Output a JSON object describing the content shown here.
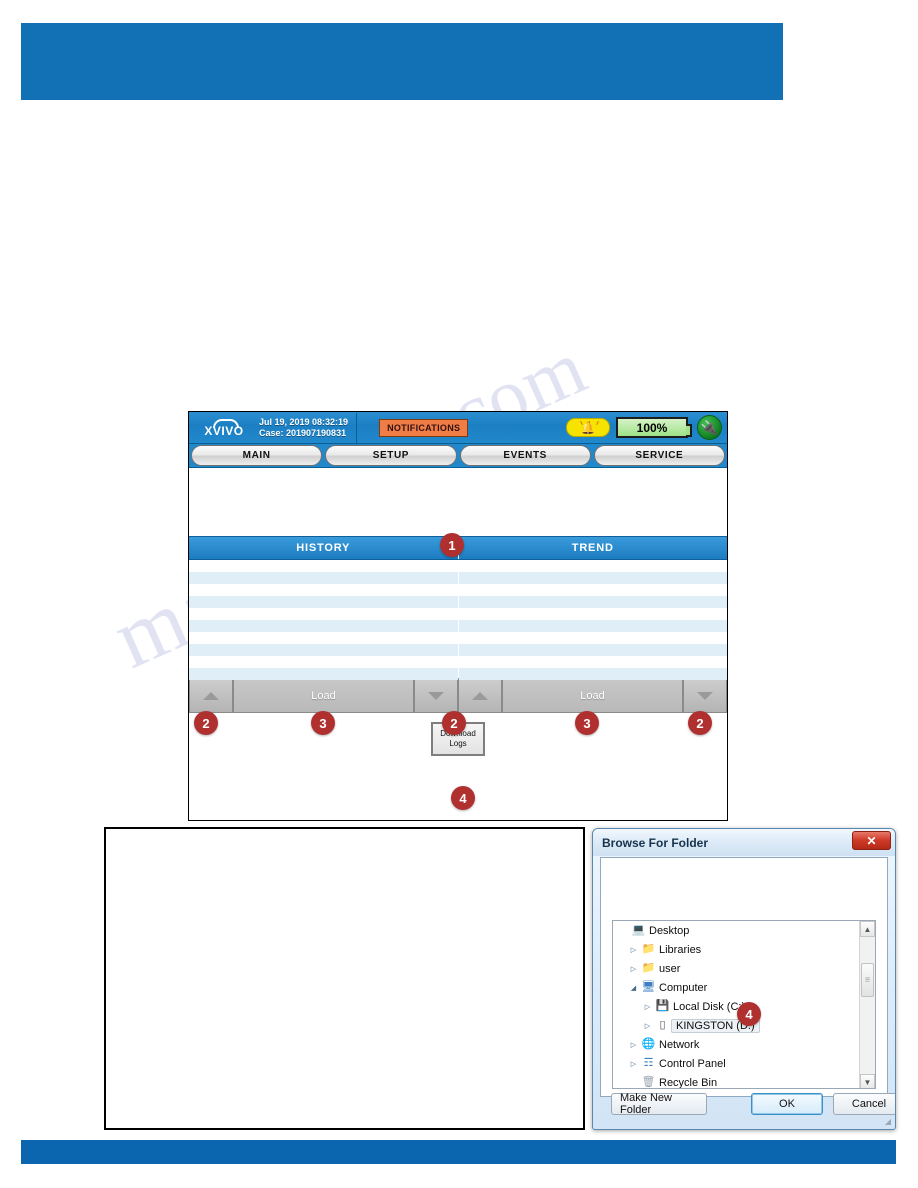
{
  "page": {
    "header_band_color": "#1271b5",
    "footer_band_color": "#0b65af",
    "watermark_text_1": "manualshive",
    "watermark_text_2": ".com"
  },
  "device": {
    "logo_text": "XVIVO",
    "datetime": "Jul 19, 2019 08:32:19",
    "case": "Case: 201907190831",
    "notifications_label": "NOTIFICATIONS",
    "battery_level": "100%",
    "alarm_icon": "bell-icon",
    "plug_icon": "power-plug-icon",
    "tabs": [
      {
        "label": "MAIN"
      },
      {
        "label": "SETUP"
      },
      {
        "label": "EVENTS"
      },
      {
        "label": "SERVICE"
      }
    ],
    "panels": [
      {
        "header": "HISTORY",
        "load_label": "Load",
        "up_icon": "triangle-up-icon",
        "down_icon": "triangle-down-icon"
      },
      {
        "header": "TREND",
        "load_label": "Load",
        "up_icon": "triangle-up-icon",
        "down_icon": "triangle-down-icon"
      }
    ],
    "download_logs": {
      "line1": "Download",
      "line2": "Logs"
    }
  },
  "callouts": {
    "c1": "1",
    "c2a": "2",
    "c2b": "2",
    "c2c": "2",
    "c3a": "3",
    "c3b": "3",
    "c4_device": "4",
    "c4_dialog": "4"
  },
  "dialog": {
    "title": "Browse For Folder",
    "close_label": "✕",
    "tree": [
      {
        "label": "Desktop",
        "indent": 0,
        "expander": "",
        "icon": "monitor-icon",
        "selected": false
      },
      {
        "label": "Libraries",
        "indent": 1,
        "expander": "▷",
        "icon": "folder-icon",
        "selected": false
      },
      {
        "label": "user",
        "indent": 1,
        "expander": "▷",
        "icon": "user-folder-icon",
        "selected": false
      },
      {
        "label": "Computer",
        "indent": 1,
        "expander": "◢",
        "icon": "computer-icon",
        "selected": false
      },
      {
        "label": "Local Disk (C:)",
        "indent": 2,
        "expander": "▷",
        "icon": "hard-disk-icon",
        "selected": false
      },
      {
        "label": "KINGSTON (D:)",
        "indent": 2,
        "expander": "▷",
        "icon": "usb-drive-icon",
        "selected": true
      },
      {
        "label": "Network",
        "indent": 1,
        "expander": "▷",
        "icon": "network-icon",
        "selected": false
      },
      {
        "label": "Control Panel",
        "indent": 1,
        "expander": "▷",
        "icon": "control-panel-icon",
        "selected": false
      },
      {
        "label": "Recycle Bin",
        "indent": 1,
        "expander": "",
        "icon": "recycle-bin-icon",
        "selected": false
      }
    ],
    "scroll_up_icon": "▲",
    "scroll_down_icon": "▼",
    "buttons": {
      "make_new_folder": "Make New Folder",
      "ok": "OK",
      "cancel": "Cancel"
    }
  }
}
